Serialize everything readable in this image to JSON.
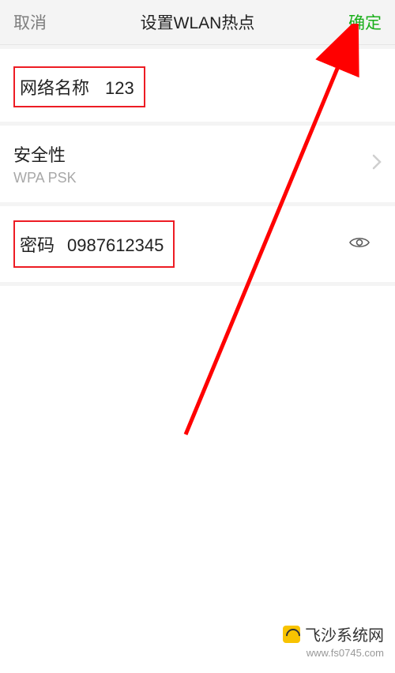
{
  "header": {
    "cancel": "取消",
    "title": "设置WLAN热点",
    "confirm": "确定"
  },
  "network": {
    "name_label": "网络名称",
    "name_value": "123"
  },
  "security": {
    "label": "安全性",
    "value": "WPA PSK"
  },
  "password": {
    "label": "密码",
    "value": "0987612345"
  },
  "watermark": {
    "title": "飞沙系统网",
    "url": "www.fs0745.com"
  }
}
